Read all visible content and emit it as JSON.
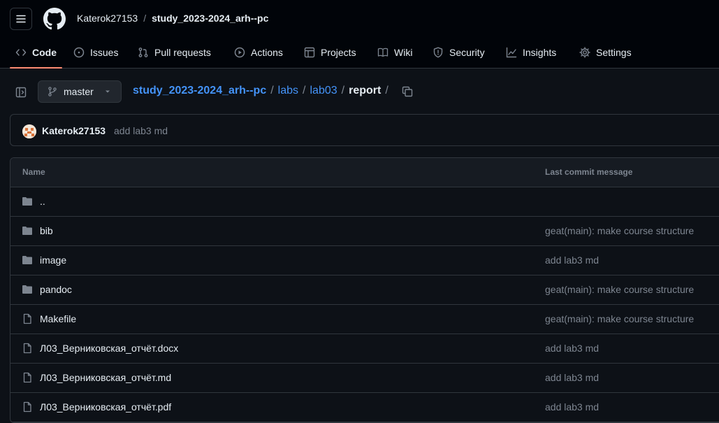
{
  "header": {
    "owner": "Katerok27153",
    "separator": "/",
    "repo": "study_2023-2024_arh--pc"
  },
  "tabs": [
    {
      "label": "Code",
      "icon": "code-icon",
      "active": true
    },
    {
      "label": "Issues",
      "icon": "issue-icon"
    },
    {
      "label": "Pull requests",
      "icon": "pull-request-icon"
    },
    {
      "label": "Actions",
      "icon": "play-icon"
    },
    {
      "label": "Projects",
      "icon": "table-icon"
    },
    {
      "label": "Wiki",
      "icon": "book-icon"
    },
    {
      "label": "Security",
      "icon": "shield-icon"
    },
    {
      "label": "Insights",
      "icon": "graph-icon"
    },
    {
      "label": "Settings",
      "icon": "gear-icon"
    }
  ],
  "branch": {
    "name": "master"
  },
  "path": {
    "root": "study_2023-2024_arh--pc",
    "parts": [
      "labs",
      "lab03"
    ],
    "current": "report",
    "sep": "/"
  },
  "commit": {
    "author": "Katerok27153",
    "message": "add lab3 md"
  },
  "files": {
    "header": {
      "name": "Name",
      "message": "Last commit message"
    },
    "rows": [
      {
        "type": "parent",
        "name": "..",
        "message": ""
      },
      {
        "type": "folder",
        "name": "bib",
        "message": "geat(main): make course structure"
      },
      {
        "type": "folder",
        "name": "image",
        "message": "add lab3 md"
      },
      {
        "type": "folder",
        "name": "pandoc",
        "message": "geat(main): make course structure"
      },
      {
        "type": "file",
        "name": "Makefile",
        "message": "geat(main): make course structure"
      },
      {
        "type": "file",
        "name": "Л03_Верниковская_отчёт.docx",
        "message": "add lab3 md"
      },
      {
        "type": "file",
        "name": "Л03_Верниковская_отчёт.md",
        "message": "add lab3 md"
      },
      {
        "type": "file",
        "name": "Л03_Верниковская_отчёт.pdf",
        "message": "add lab3 md"
      }
    ]
  },
  "colors": {
    "background": "#0d1117",
    "header_bg": "#010409",
    "link": "#4493f8",
    "active_tab_underline": "#fd8c73",
    "muted": "#7d8590"
  }
}
